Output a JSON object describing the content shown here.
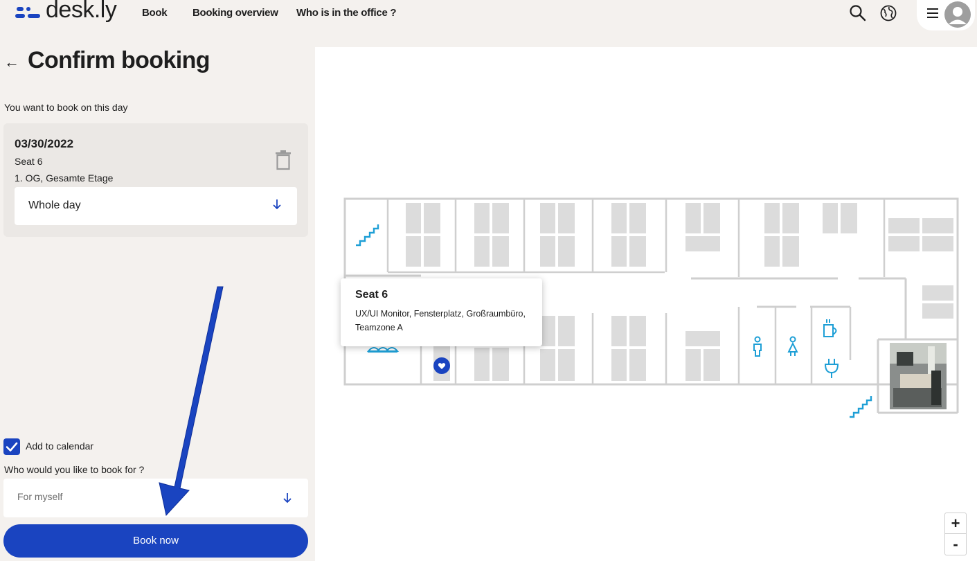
{
  "app": {
    "logo_text": "desk.ly",
    "brand_color": "#1a44c0"
  },
  "nav": {
    "book": "Book",
    "overview": "Booking overview",
    "office": "Who is in the office ?"
  },
  "header_icons": {
    "search": "search-icon",
    "language": "globe-icon",
    "menu": "menu-icon",
    "avatar": "avatar-icon"
  },
  "page": {
    "title": "Confirm booking",
    "intro": "You want to book on this day"
  },
  "booking": {
    "date": "03/30/2022",
    "seat": "Seat 6",
    "location": "1. OG, Gesamte Etage",
    "duration": "Whole day"
  },
  "calendar": {
    "label": "Add to calendar",
    "checked": true
  },
  "book_for": {
    "label": "Who would you like to book for ?",
    "value": "For myself"
  },
  "book_button": "Book now",
  "tooltip": {
    "title": "Seat 6",
    "description": "UX/UI Monitor, Fensterplatz, Großraumbüro, Teamzone A"
  },
  "zoom": {
    "in": "+",
    "out": "-"
  }
}
